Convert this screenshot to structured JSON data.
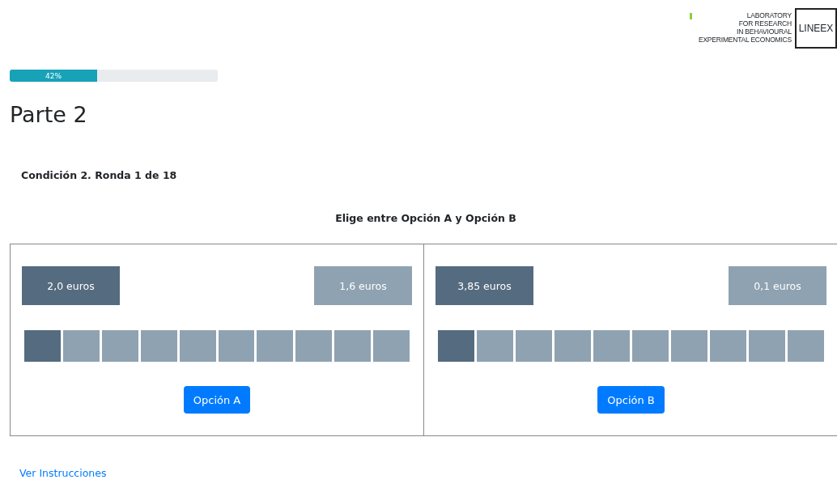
{
  "logo": {
    "lines": [
      "LABORATORY",
      "FOR RESEARCH",
      "IN BEHAVIOURAL",
      "EXPERIMENTAL ECONOMICS"
    ],
    "mark": "LINEEX"
  },
  "progress": {
    "label": "42%",
    "level": 0.42
  },
  "title": "Parte 2",
  "round": "Condición 2. Ronda 1 de 18",
  "prompt": "Elige entre Opción A y Opción B",
  "options": [
    {
      "high": "2,0 euros",
      "low": "1,6 euros",
      "button": "Opción A",
      "boxes": [
        {
          "high": true
        },
        {
          "high": false
        },
        {
          "high": false
        },
        {
          "high": false
        },
        {
          "high": false
        },
        {
          "high": false
        },
        {
          "high": false
        },
        {
          "high": false
        },
        {
          "high": false
        },
        {
          "high": false
        }
      ]
    },
    {
      "high": "3,85 euros",
      "low": "0,1 euros",
      "button": "Opción B",
      "boxes": [
        {
          "high": true
        },
        {
          "high": false
        },
        {
          "high": false
        },
        {
          "high": false
        },
        {
          "high": false
        },
        {
          "high": false
        },
        {
          "high": false
        },
        {
          "high": false
        },
        {
          "high": false
        },
        {
          "high": false
        }
      ]
    }
  ],
  "link": "Ver Instrucciones"
}
